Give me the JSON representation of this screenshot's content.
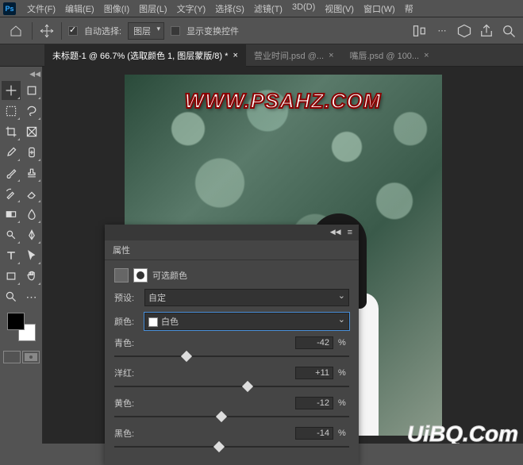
{
  "menu": {
    "items": [
      "文件(F)",
      "编辑(E)",
      "图像(I)",
      "图层(L)",
      "文字(Y)",
      "选择(S)",
      "滤镜(T)",
      "3D(D)",
      "视图(V)",
      "窗口(W)",
      "帮"
    ]
  },
  "options": {
    "auto_select_label": "自动选择:",
    "auto_select_target": "图层",
    "show_transform_label": "显示变换控件"
  },
  "tabs": [
    {
      "label": "未标题-1 @ 66.7% (选取颜色 1, 图层蒙版/8) *",
      "active": true
    },
    {
      "label": "营业时间.psd @...",
      "active": false
    },
    {
      "label": "嘴唇.psd @ 100...",
      "active": false
    }
  ],
  "canvas": {
    "watermark1": "WWW.PSAHZ.COM",
    "watermark2": "UiBQ.Com"
  },
  "panel": {
    "title": "属性",
    "adj_name": "可选颜色",
    "preset_label": "预设:",
    "preset_value": "自定",
    "color_label": "颜色:",
    "color_value": "白色",
    "sliders": [
      {
        "label": "青色:",
        "value": "-42",
        "pos": 29
      },
      {
        "label": "洋红:",
        "value": "+11",
        "pos": 55
      },
      {
        "label": "黄色:",
        "value": "-12",
        "pos": 44
      },
      {
        "label": "黑色:",
        "value": "-14",
        "pos": 43
      }
    ],
    "percent": "%"
  }
}
